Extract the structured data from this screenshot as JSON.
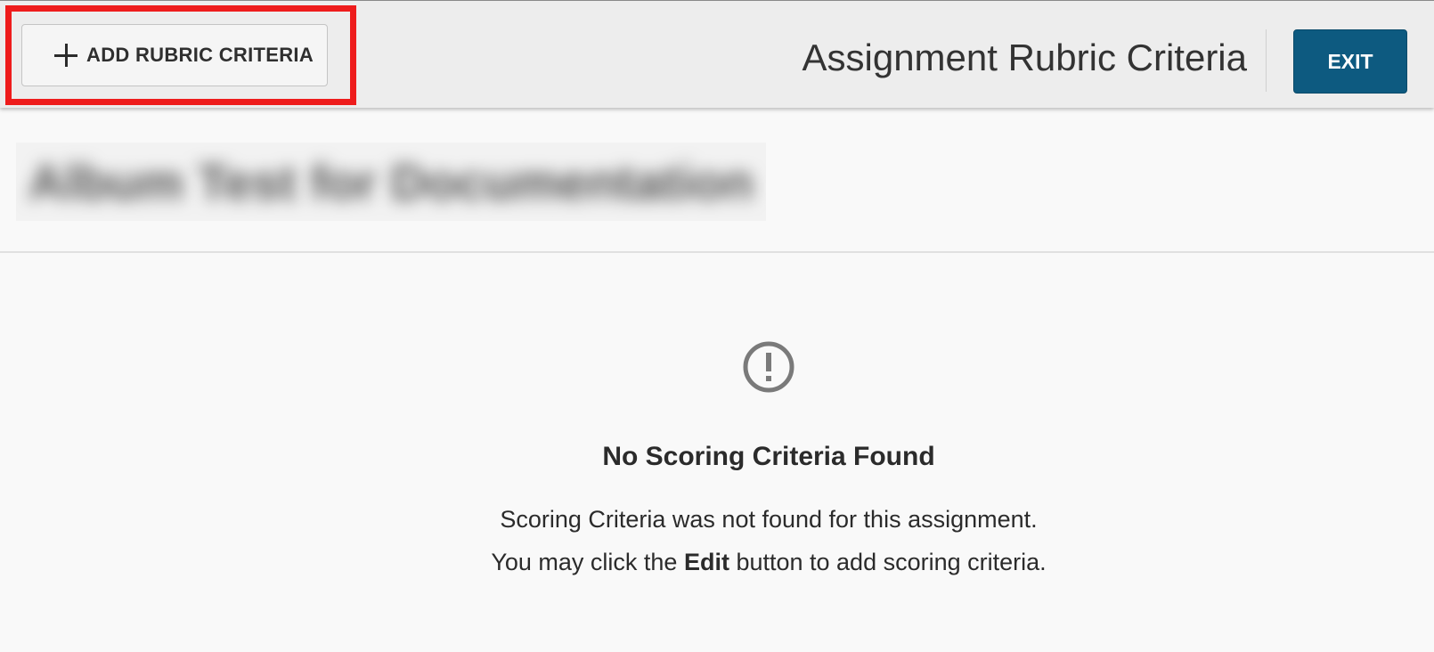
{
  "header": {
    "add_button_label": "ADD RUBRIC CRITERIA",
    "title": "Assignment Rubric Criteria",
    "exit_label": "EXIT"
  },
  "assignment": {
    "name": "Album Test for Documentation"
  },
  "empty_state": {
    "icon": "exclamation-circle-icon",
    "title": "No Scoring Criteria Found",
    "line1": "Scoring Criteria was not found for this assignment.",
    "line2_prefix": "You may click the ",
    "line2_bold": "Edit",
    "line2_suffix": " button to add scoring criteria."
  },
  "colors": {
    "accent": "#0d5a80",
    "highlight": "#ee1c1c",
    "header_bg": "#ededed",
    "page_bg": "#f9f9f9"
  }
}
